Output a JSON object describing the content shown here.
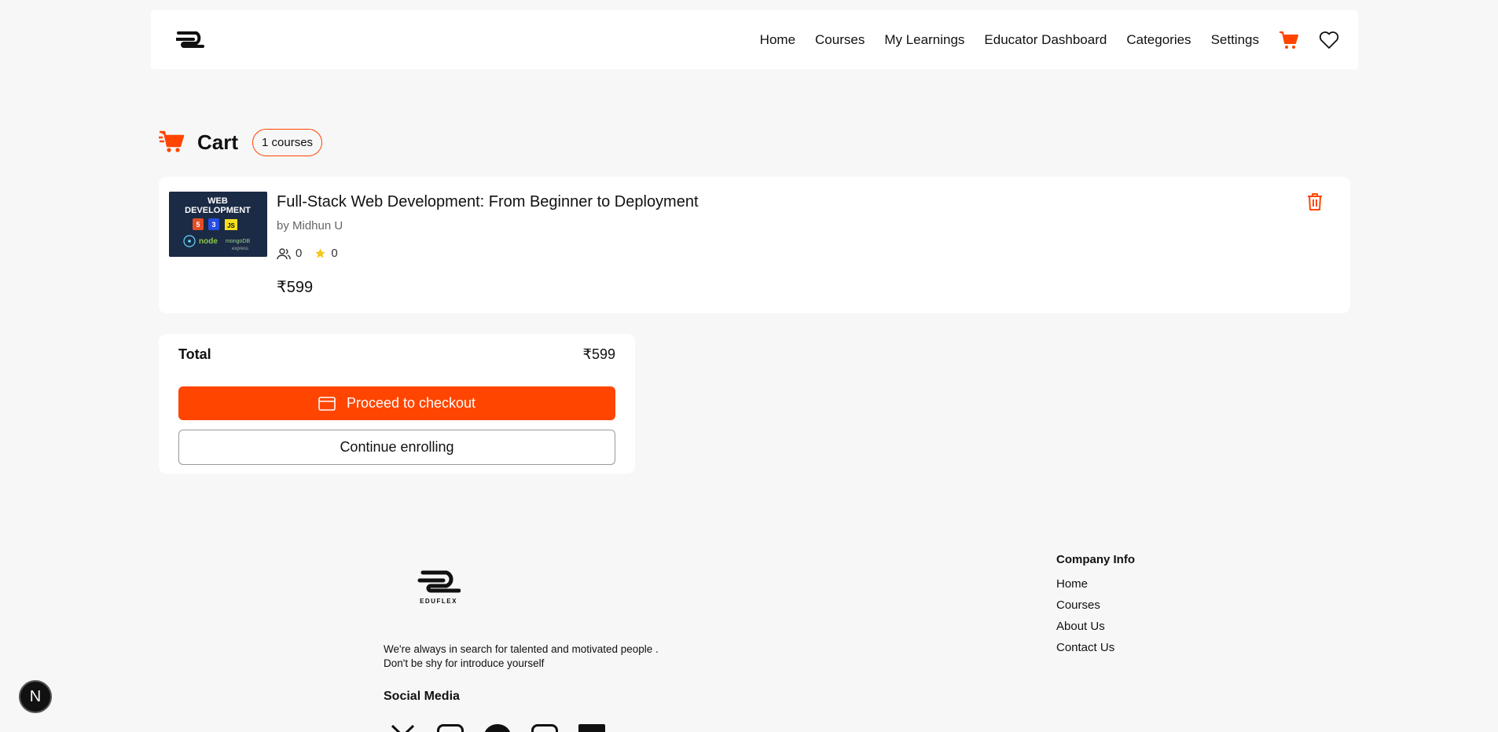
{
  "header": {
    "nav": [
      "Home",
      "Courses",
      "My Learnings",
      "Educator Dashboard",
      "Categories",
      "Settings"
    ],
    "icons": [
      "cart-icon",
      "heart-icon"
    ],
    "accent": "#ff4500"
  },
  "cart": {
    "title": "Cart",
    "badge": "1 courses"
  },
  "item": {
    "thumbnail_text": "WEB DEVELOPMENT",
    "thumbnail_tags": [
      "5",
      "3",
      "JS",
      "node",
      "mongoDB",
      "express"
    ],
    "title": "Full-Stack Web Development: From Beginner to Deployment",
    "author": "by Midhun U",
    "students": "0",
    "rating": "0",
    "price": "₹599"
  },
  "summary": {
    "total_label": "Total",
    "total_value": "₹599",
    "checkout_label": "Proceed to checkout",
    "continue_label": "Continue enrolling"
  },
  "footer": {
    "brand": "EDUFLEX",
    "tagline_1": "We're always in search for talented and motivated people .",
    "tagline_2": "Don't be shy for introduce yourself",
    "social_title": "Social Media",
    "company_title": "Company Info",
    "company_links": [
      "Home",
      "Courses",
      "About Us",
      "Contact Us"
    ]
  },
  "dev_badge": "N"
}
